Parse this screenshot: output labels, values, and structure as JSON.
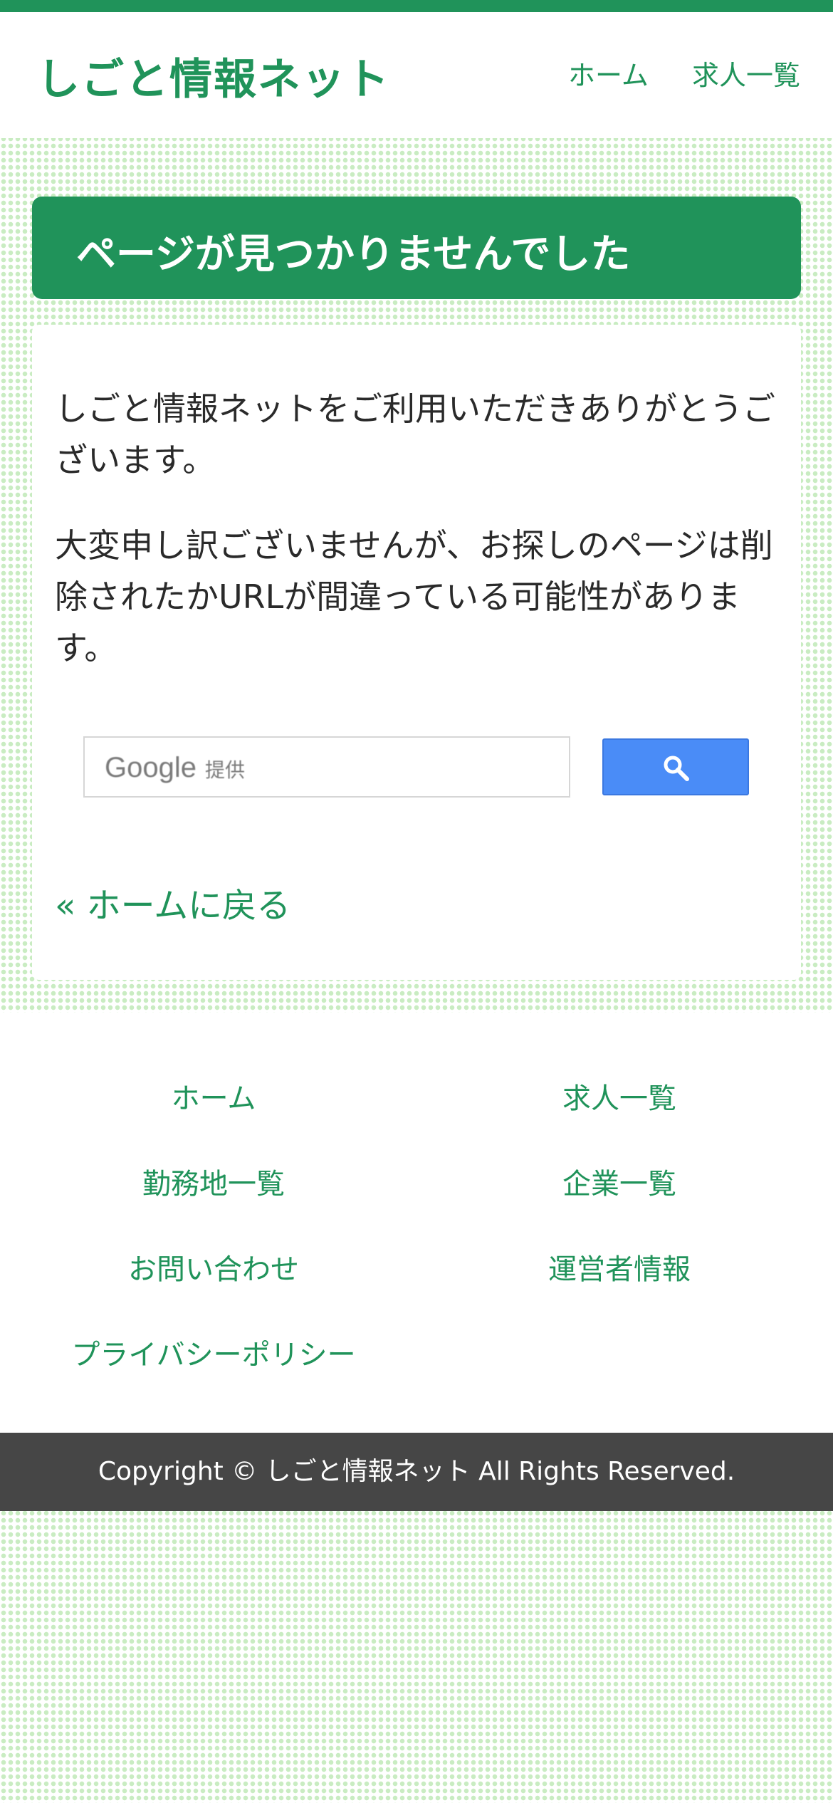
{
  "header": {
    "site_title": "しごと情報ネット",
    "nav": [
      {
        "label": "ホーム"
      },
      {
        "label": "求人一覧"
      }
    ]
  },
  "main": {
    "page_title": "ページが見つかりませんでした",
    "paragraphs": [
      "しごと情報ネットをご利用いただきありがとうございます。",
      "大変申し訳ございませんが、お探しのページは削除されたかURLが間違っている可能性があります。"
    ],
    "search": {
      "brand": "Google",
      "brand_suffix": "提供",
      "button_icon": "search-icon"
    },
    "back_link": "« ホームに戻る"
  },
  "footer": {
    "links": [
      {
        "label": "ホーム"
      },
      {
        "label": "求人一覧"
      },
      {
        "label": "勤務地一覧"
      },
      {
        "label": "企業一覧"
      },
      {
        "label": "お問い合わせ"
      },
      {
        "label": "運営者情報"
      },
      {
        "label": "プライバシーポリシー"
      }
    ],
    "copyright": "Copyright © しごと情報ネット All Rights Reserved."
  },
  "colors": {
    "brand_green": "#20935a",
    "search_button": "#4a8cf7",
    "footer_bar": "#464646"
  }
}
